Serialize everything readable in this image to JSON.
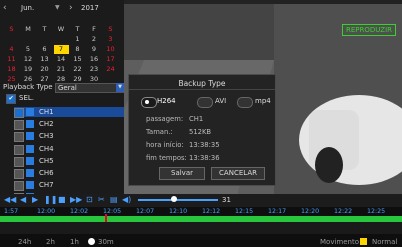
{
  "calendar": {
    "month": "Jun.",
    "year": "2017",
    "weekdays": [
      "S",
      "M",
      "T",
      "W",
      "T",
      "F",
      "S"
    ],
    "rows": [
      [
        "",
        "",
        "",
        "",
        "1",
        "2",
        "3"
      ],
      [
        "4",
        "5",
        "6",
        "7",
        "8",
        "9",
        "10"
      ],
      [
        "11",
        "12",
        "13",
        "14",
        "15",
        "16",
        "17"
      ],
      [
        "18",
        "19",
        "20",
        "21",
        "22",
        "23",
        "24"
      ],
      [
        "25",
        "26",
        "27",
        "28",
        "29",
        "30",
        ""
      ]
    ],
    "selected_day": "7"
  },
  "playback_type_label": "Playback Type",
  "playback_type_value": "Geral",
  "select_all_label": "SEL.",
  "channels": [
    "CH1",
    "CH2",
    "CH3",
    "CH4",
    "CH5",
    "CH6",
    "CH7",
    "CH8"
  ],
  "reproduzir_label": "REPRODUZIR",
  "dialog": {
    "title": "Backup Type",
    "formats": [
      "H264",
      "AVI",
      "mp4"
    ],
    "passagem_label": "passagem:",
    "passagem_value": "CH1",
    "taman_label": "Taman.:",
    "taman_value": "512KB",
    "hora_inicio_label": "hora início:",
    "hora_inicio_value": "13:38:35",
    "fim_label": "fim tempos:",
    "fim_value": "13:38:36",
    "save_label": "Salvar",
    "cancel_label": "CANCELAR"
  },
  "timeline": {
    "ticks": [
      "1:57",
      "12:00",
      "12:02",
      "12:05",
      "12:07",
      "12:10",
      "12:12",
      "12:15",
      "12:17",
      "12:20",
      "12:22",
      "12:25"
    ],
    "volume_value": "31",
    "zoom_options": [
      "24h",
      "2h",
      "1h",
      "30m"
    ],
    "legend_movimento": "Movimento",
    "legend_normal": "Normal"
  },
  "colors": {
    "accent": "#1a6fd0",
    "selected_day": "#ffd500",
    "record_green": "#27c63d"
  }
}
